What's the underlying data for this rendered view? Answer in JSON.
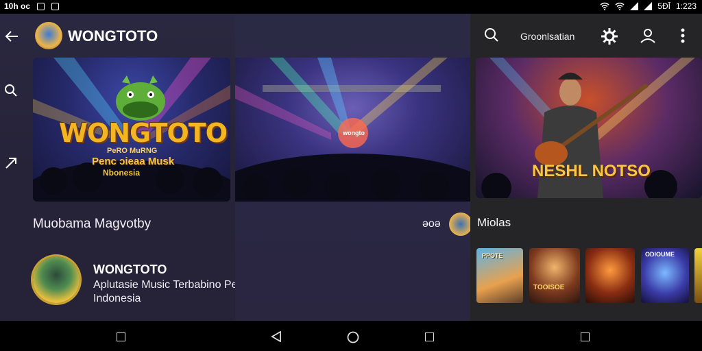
{
  "status_bar": {
    "time_left": "10h oc",
    "time_right": "1:223",
    "battery_text": "5ĐĪ"
  },
  "left_panel": {
    "app_name": "WONGTOTO",
    "banner": {
      "logo_text": "WONGTOTO",
      "tagline_small": "PeRO MuRNG",
      "tagline": "Penc ɔieaa Musk",
      "country": "Nbonesia"
    },
    "section_title": "Muobama Magvotby",
    "profile": {
      "name": "WONGTOTO",
      "description": "Aplutasie Music Terbabino Petuo Pengimar Musik Indonesia"
    }
  },
  "middle_panel": {
    "stage_sign": "wongto",
    "side_label": "əoə"
  },
  "right_panel": {
    "header_label": "Groonlsatian",
    "banner_text": "NESHL NOTSO",
    "section_title": "Miolas",
    "thumbnails": [
      {
        "label": "PPOTE"
      },
      {
        "label": "TOOISOE"
      },
      {
        "label": ""
      },
      {
        "label": "ODIOUME"
      }
    ]
  },
  "colors": {
    "accent_gold": "#f3b623",
    "panel_bg": "#262338",
    "right_bg": "#252426"
  }
}
